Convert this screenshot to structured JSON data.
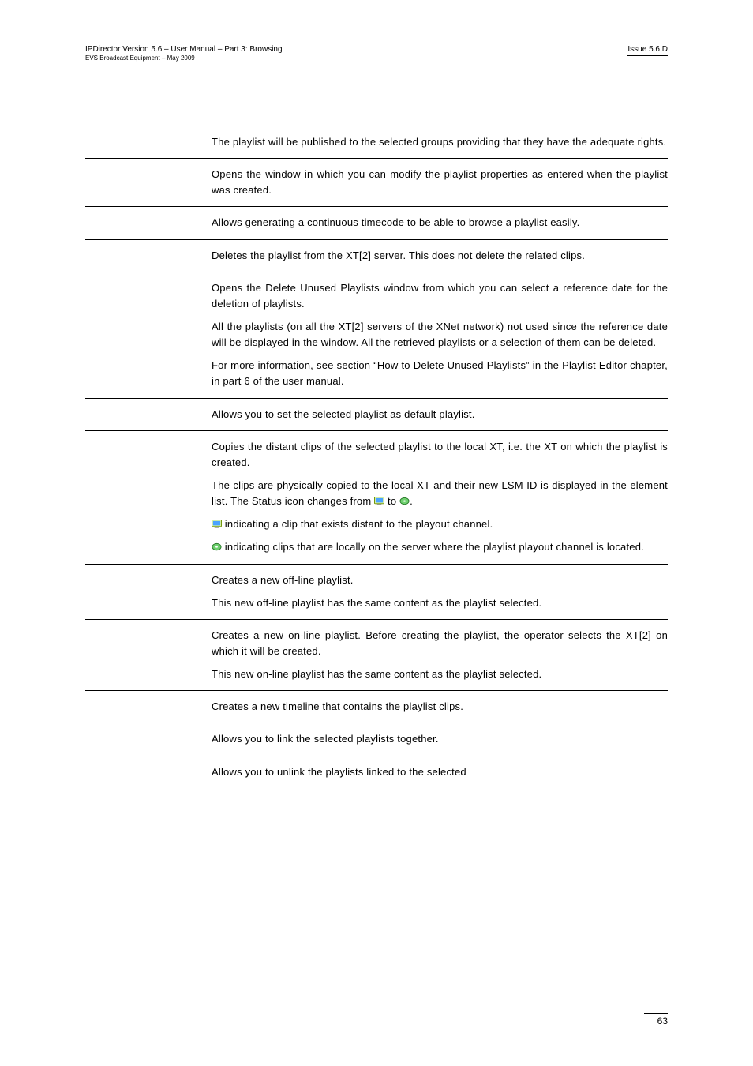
{
  "header": {
    "product_line1": "IPDirector Version 5.6 – User Manual – Part 3: Browsing",
    "product_line2": "EVS Broadcast Equipment – May 2009",
    "issue": "Issue 5.6.D"
  },
  "rows": [
    {
      "paras": [
        "The playlist will be published to the selected groups providing that they have the adequate rights."
      ]
    },
    {
      "paras": [
        "Opens the                         window in which you can modify the playlist properties as entered when the playlist was created."
      ]
    },
    {
      "paras": [
        "Allows generating a continuous timecode to be able to browse a playlist easily."
      ]
    },
    {
      "paras": [
        "Deletes the playlist from the XT[2] server. This does not delete the related clips."
      ]
    },
    {
      "paras": [
        "Opens the Delete Unused Playlists window from which you can select a reference date for the deletion of playlists.",
        "All the playlists (on all the XT[2] servers of the XNet network) not used since the reference date will be displayed in the window. All the retrieved playlists or a selection of them can be deleted.",
        "For more information, see section “How to Delete Unused Playlists” in the Playlist Editor chapter, in part 6 of the user manual."
      ]
    },
    {
      "paras": [
        "Allows you to set the selected playlist as default playlist."
      ]
    },
    {
      "paras": [
        "Copies the distant clips of the selected playlist to the local XT, i.e. the XT on which the playlist is created.",
        "__ICONROW1__",
        "__ICONROW2__",
        "__ICONROW3__"
      ],
      "icon_text_1_a": "The clips are physically copied to the local XT and their new LSM ID is displayed in the element list. The Status icon changes from ",
      "icon_text_1_b": " to ",
      "icon_text_1_c": ".",
      "icon_text_2_a": " indicating a clip that exists distant to the playout channel.",
      "icon_text_3_a": " indicating clips that are locally on the server where the playlist playout channel is located."
    },
    {
      "paras": [
        "Creates a new off-line playlist.",
        "This new off-line playlist has the same content as the playlist selected."
      ]
    },
    {
      "paras": [
        "Creates a new on-line playlist. Before creating the playlist, the operator selects the XT[2] on which it will be created.",
        "This new on-line playlist has the same content as the playlist selected."
      ]
    },
    {
      "paras": [
        "Creates a new timeline that contains the playlist clips."
      ]
    },
    {
      "paras": [
        "Allows you to link the selected playlists together."
      ]
    },
    {
      "paras": [
        "Allows you to unlink the playlists linked to the selected"
      ],
      "no_bottom_border": true
    }
  ],
  "footer": {
    "page": "63"
  }
}
